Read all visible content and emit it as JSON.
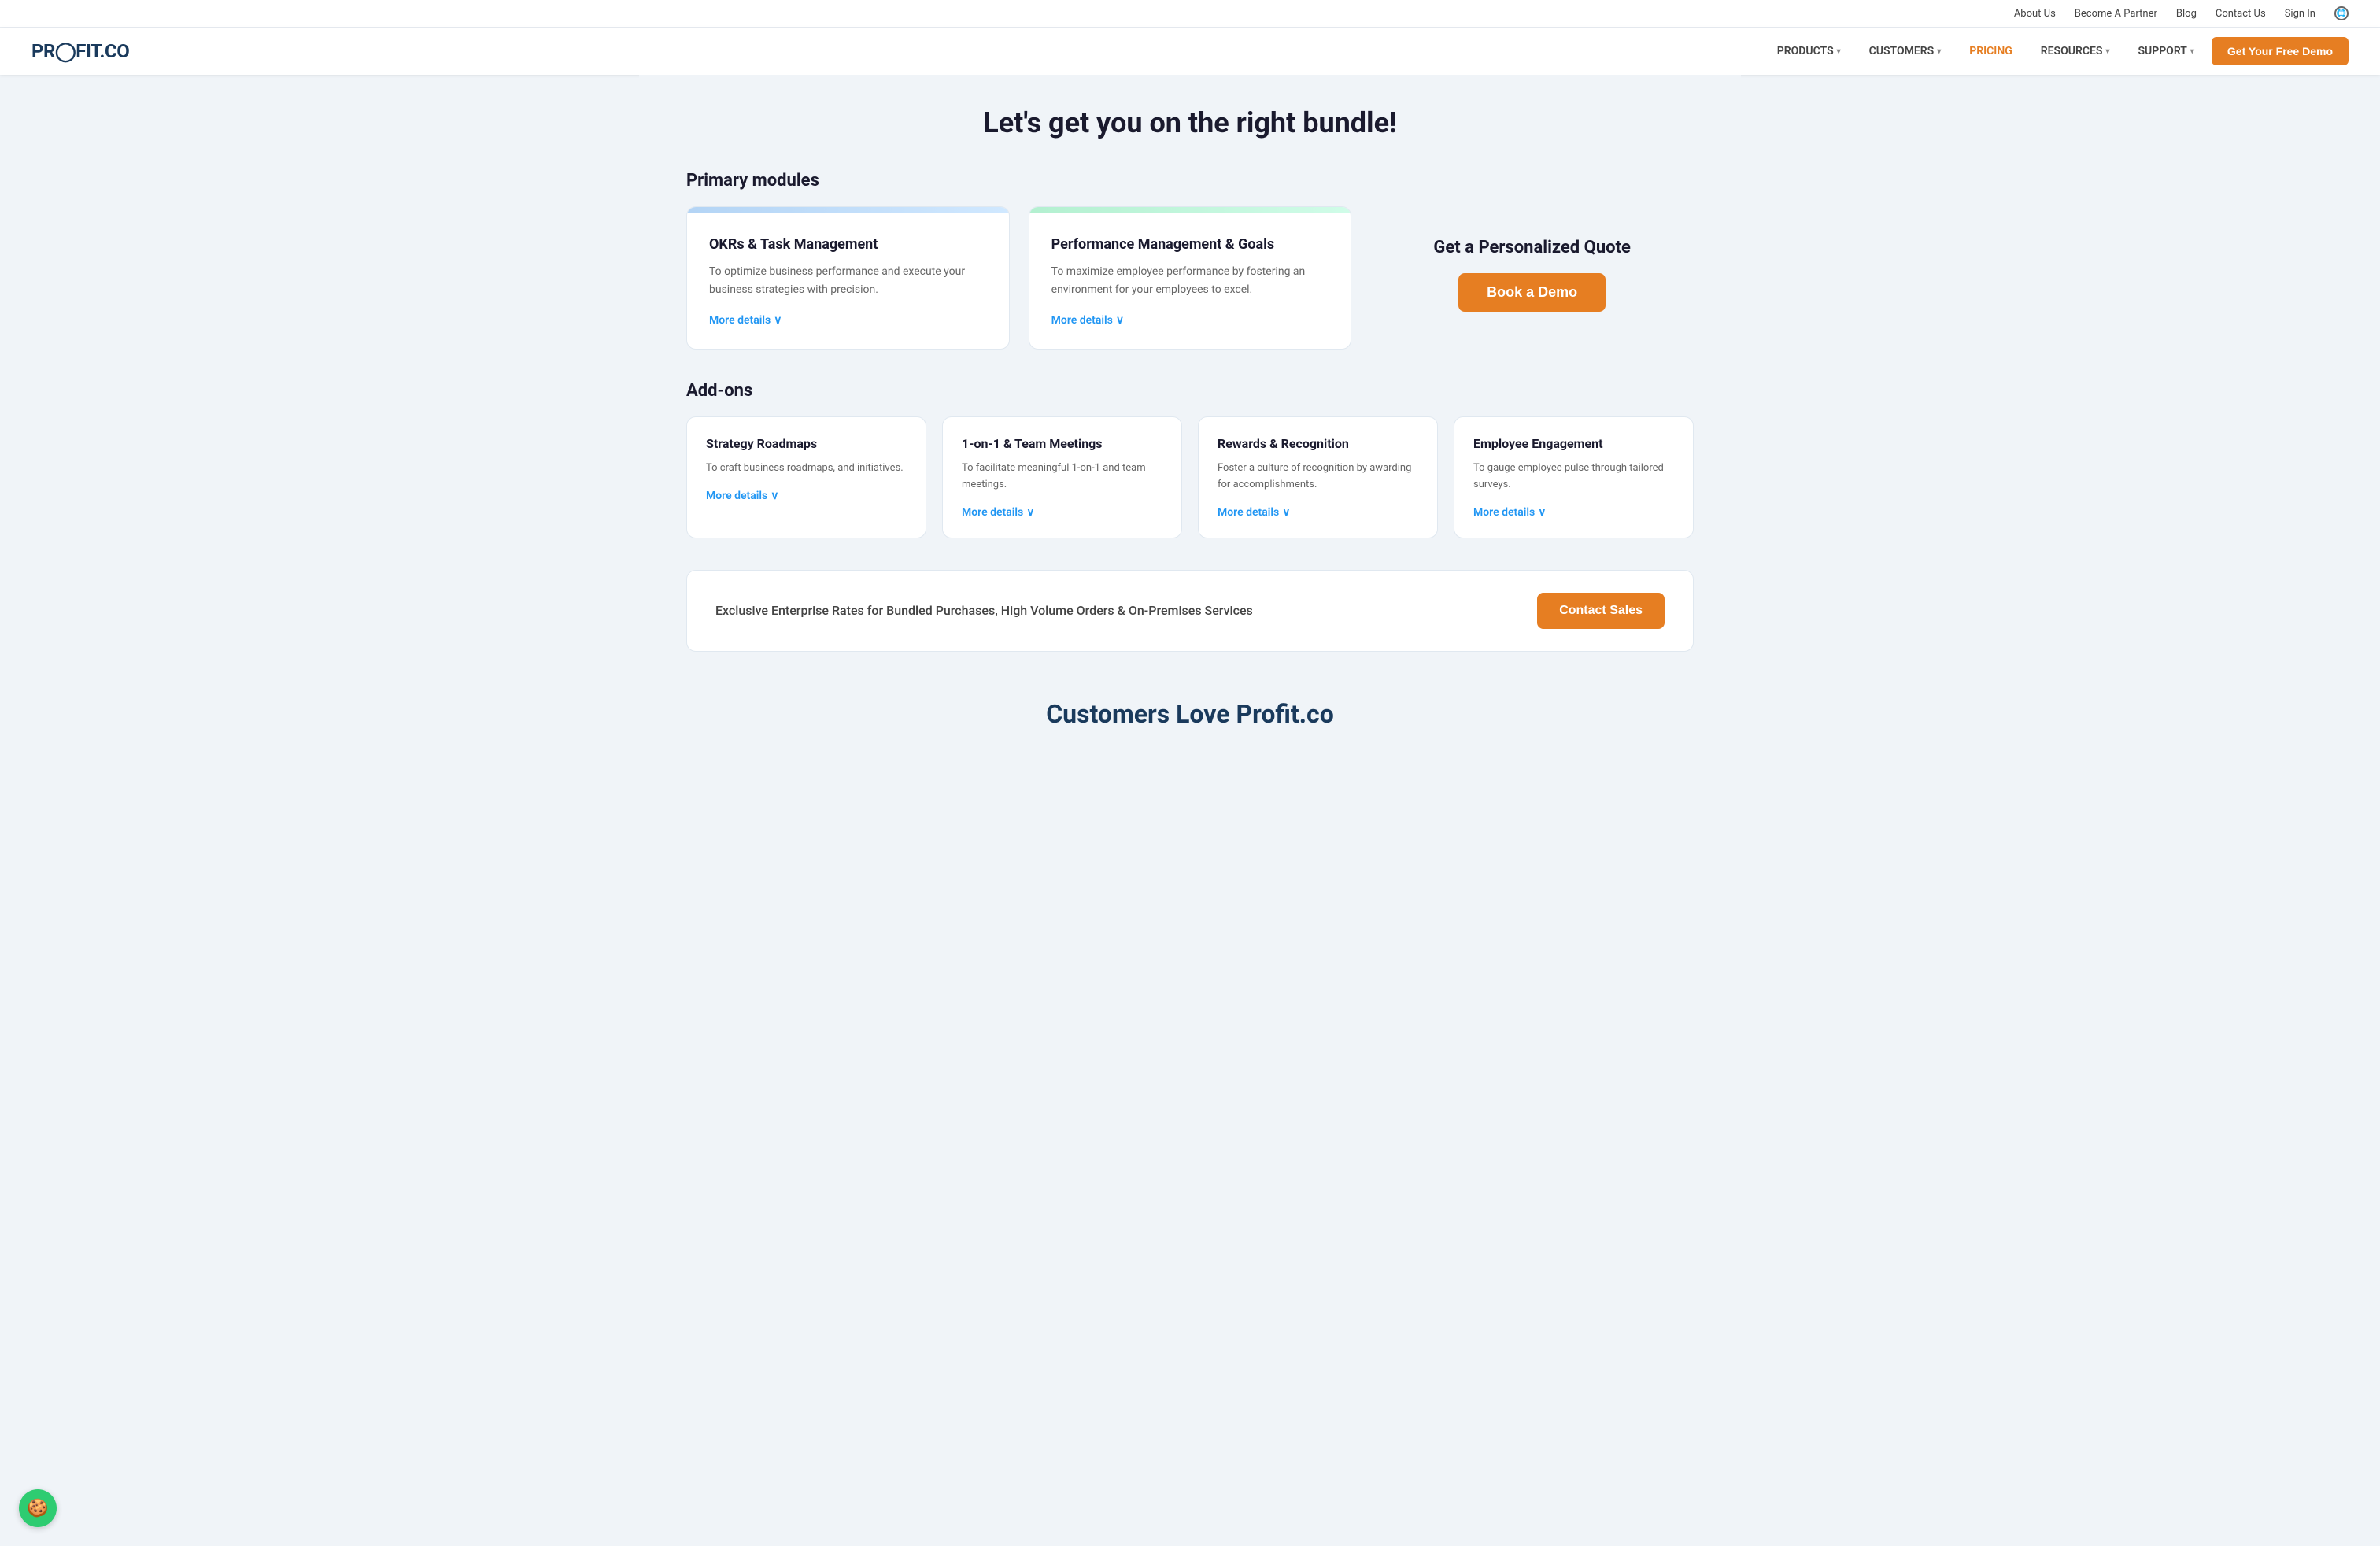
{
  "topbar": {
    "links": [
      {
        "label": "About Us",
        "name": "about-us-link"
      },
      {
        "label": "Become A Partner",
        "name": "partner-link"
      },
      {
        "label": "Blog",
        "name": "blog-link"
      },
      {
        "label": "Contact Us",
        "name": "contact-us-link"
      },
      {
        "label": "Sign In",
        "name": "sign-in-link"
      }
    ]
  },
  "nav": {
    "logo": "PR FIT.CO",
    "logo_prefix": "PR",
    "logo_suffix": "IT.CO",
    "items": [
      {
        "label": "PRODUCTS",
        "name": "products-nav",
        "has_dropdown": true
      },
      {
        "label": "CUSTOMERS",
        "name": "customers-nav",
        "has_dropdown": true
      },
      {
        "label": "PRICING",
        "name": "pricing-nav",
        "has_dropdown": false,
        "active": true
      },
      {
        "label": "RESOURCES",
        "name": "resources-nav",
        "has_dropdown": true
      },
      {
        "label": "SUPPORT",
        "name": "support-nav",
        "has_dropdown": true
      }
    ],
    "cta_label": "Get Your Free Demo"
  },
  "page": {
    "title": "Let's get you on the right bundle!"
  },
  "primary_modules": {
    "section_title": "Primary modules",
    "cards": [
      {
        "name": "okr-card",
        "title": "OKRs & Task Management",
        "description": "To optimize business performance and execute your business strategies with precision.",
        "more_details_label": "More details"
      },
      {
        "name": "performance-card",
        "title": "Performance Management & Goals",
        "description": "To maximize employee performance by fostering an environment for your employees to excel.",
        "more_details_label": "More details"
      }
    ],
    "quote_box": {
      "title": "Get a Personalized Quote",
      "button_label": "Book a Demo"
    }
  },
  "addons": {
    "section_title": "Add-ons",
    "cards": [
      {
        "name": "strategy-roadmaps-card",
        "title": "Strategy Roadmaps",
        "description": "To craft business roadmaps, and initiatives.",
        "more_details_label": "More details"
      },
      {
        "name": "team-meetings-card",
        "title": "1-on-1 & Team Meetings",
        "description": "To facilitate meaningful 1-on-1 and team meetings.",
        "more_details_label": "More details"
      },
      {
        "name": "rewards-card",
        "title": "Rewards & Recognition",
        "description": "Foster a culture of recognition by awarding for accomplishments.",
        "more_details_label": "More details"
      },
      {
        "name": "engagement-card",
        "title": "Employee Engagement",
        "description": "To gauge employee pulse through tailored surveys.",
        "more_details_label": "More details"
      }
    ]
  },
  "enterprise_banner": {
    "text": "Exclusive Enterprise Rates for Bundled Purchases, High Volume Orders & On-Premises Services",
    "button_label": "Contact Sales"
  },
  "customers_section": {
    "title": "Customers Love Profit.co"
  },
  "cookie": {
    "icon": "🍪"
  }
}
